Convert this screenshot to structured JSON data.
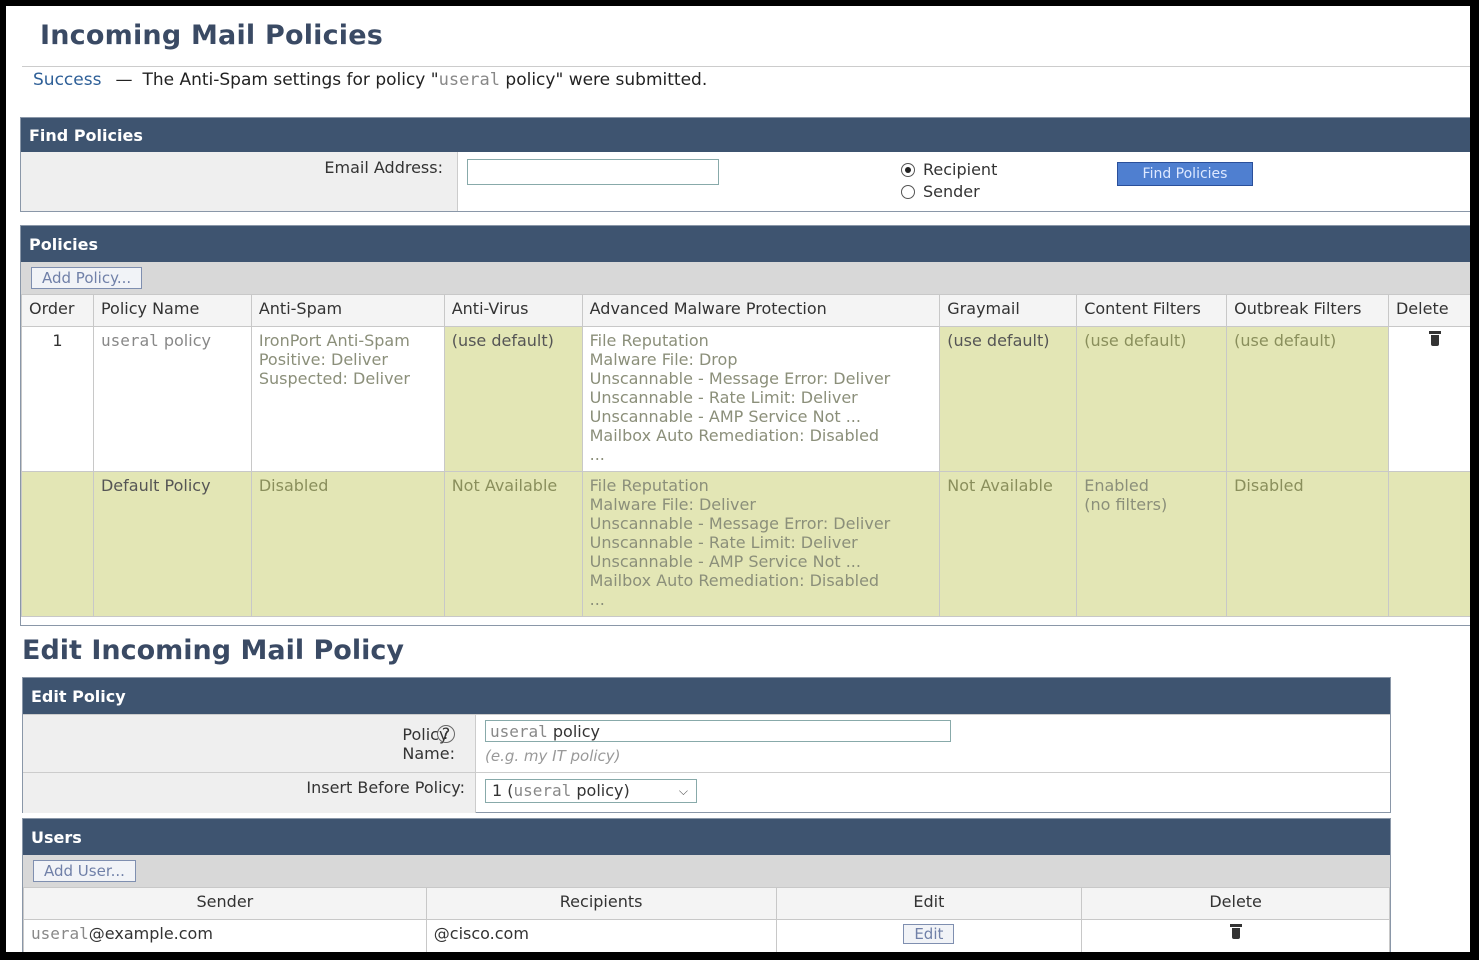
{
  "page": {
    "title": "Incoming Mail Policies",
    "success_label": "Success",
    "success_dash": "—",
    "success_msg_pre": "The Anti-Spam settings for policy \"",
    "success_msg_policy": "useral",
    "success_msg_post": " policy\" were submitted."
  },
  "find": {
    "header": "Find Policies",
    "email_label": "Email Address:",
    "email_value": "",
    "radio_recipient": "Recipient",
    "radio_sender": "Sender",
    "button": "Find Policies"
  },
  "policies": {
    "header": "Policies",
    "add_button": "Add Policy...",
    "columns": [
      "Order",
      "Policy Name",
      "Anti-Spam",
      "Anti-Virus",
      "Advanced Malware Protection",
      "Graymail",
      "Content Filters",
      "Outbreak Filters",
      "Delete"
    ],
    "rows": [
      {
        "order": "1",
        "name_user": "useral",
        "name_rest": " policy",
        "antispam": [
          "IronPort Anti-Spam",
          "Positive: Deliver",
          "Suspected: Deliver"
        ],
        "antivirus": "(use default)",
        "amp": [
          "File Reputation",
          "Malware File: Drop",
          "Unscannable - Message Error: Deliver",
          "Unscannable - Rate Limit: Deliver",
          "Unscannable - AMP Service Not ...",
          "Mailbox Auto Remediation: Disabled",
          "..."
        ],
        "graymail": "(use default)",
        "content": "(use default)",
        "outbreak": "(use default)"
      },
      {
        "order": "",
        "name": "Default Policy",
        "antispam": [
          "Disabled"
        ],
        "antivirus": "Not Available",
        "amp": [
          "File Reputation",
          "Malware File: Deliver",
          "Unscannable - Message Error: Deliver",
          "Unscannable - Rate Limit: Deliver",
          "Unscannable - AMP Service Not ...",
          "Mailbox Auto Remediation: Disabled",
          "..."
        ],
        "graymail": "Not Available",
        "content": [
          "Enabled",
          "(no filters)"
        ],
        "outbreak": "Disabled"
      }
    ]
  },
  "edit": {
    "title": "Edit Incoming Mail Policy",
    "header": "Edit Policy",
    "name_label": "Policy Name:",
    "help": "?",
    "name_value_user": "useral",
    "name_value_rest": " policy",
    "name_hint": "(e.g. my IT policy)",
    "insert_label": "Insert Before Policy:",
    "insert_value_pre": "1 (",
    "insert_value_user": "useral",
    "insert_value_post": " policy)",
    "chevron": "⌵"
  },
  "users": {
    "header": "Users",
    "add_button": "Add User...",
    "columns": [
      "Sender",
      "Recipients",
      "Edit",
      "Delete"
    ],
    "rows": [
      {
        "sender_user": "useral",
        "sender_domain": "@example.com",
        "recipients": "@cisco.com",
        "edit": "Edit"
      }
    ]
  }
}
